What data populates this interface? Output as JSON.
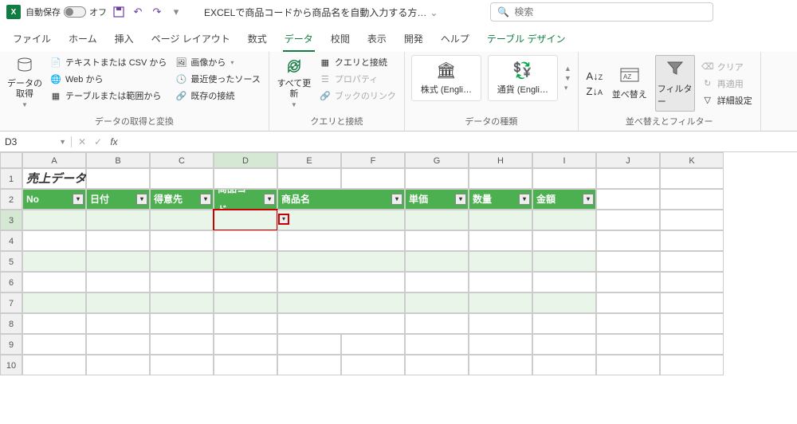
{
  "titlebar": {
    "autosave_label": "自動保存",
    "autosave_state": "オフ",
    "doc_title": "EXCELで商品コードから商品名を自動入力する方…",
    "search_placeholder": "検索"
  },
  "tabs": [
    "ファイル",
    "ホーム",
    "挿入",
    "ページ レイアウト",
    "数式",
    "データ",
    "校閲",
    "表示",
    "開発",
    "ヘルプ",
    "テーブル デザイン"
  ],
  "active_tab_index": 5,
  "ribbon": {
    "group1": {
      "label": "データの取得と変換",
      "get_data": "データの取得",
      "items": [
        "テキストまたは CSV から",
        "Web から",
        "テーブルまたは範囲から",
        "画像から",
        "最近使ったソース",
        "既存の接続"
      ]
    },
    "group2": {
      "label": "クエリと接続",
      "refresh": "すべて更新",
      "items": [
        "クエリと接続",
        "プロパティ",
        "ブックのリンク"
      ]
    },
    "group3": {
      "label": "データの種類",
      "stocks": "株式 (Engli…",
      "currency": "通貨 (Engli…"
    },
    "group4": {
      "label": "並べ替えとフィルター",
      "sort": "並べ替え",
      "filter": "フィルター",
      "items": [
        "クリア",
        "再適用",
        "詳細設定"
      ]
    }
  },
  "namebox": "D3",
  "columns": [
    "A",
    "B",
    "C",
    "D",
    "E",
    "F",
    "G",
    "H",
    "I",
    "J",
    "K"
  ],
  "rows": [
    "1",
    "2",
    "3",
    "4",
    "5",
    "6",
    "7",
    "8",
    "9",
    "10"
  ],
  "sheet": {
    "title": "売上データ",
    "headers": [
      "No",
      "日付",
      "得意先",
      "商品コード",
      "商品名",
      "単価",
      "数量",
      "金額"
    ]
  }
}
